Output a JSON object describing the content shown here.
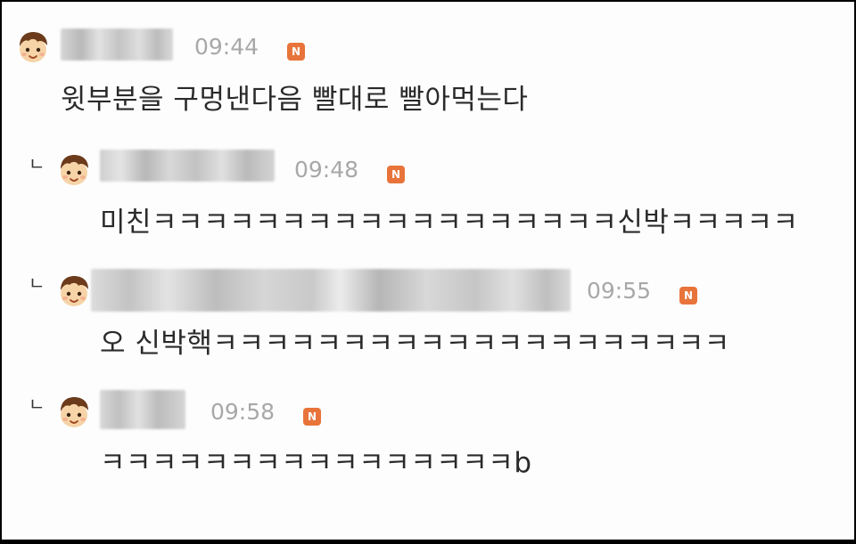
{
  "comments": [
    {
      "is_reply": false,
      "reply_marker": "",
      "time": "09:44",
      "badge": "N",
      "text": "윗부분을 구멍낸다음 빨대로 빨아먹는다",
      "avatar_icon": "boy-face-avatar-icon",
      "username_blurred": true
    },
    {
      "is_reply": true,
      "reply_marker": "ㄴ",
      "time": "09:48",
      "badge": "N",
      "text": "미친ㅋㅋㅋㅋㅋㅋㅋㅋㅋㅋㅋㅋㅋㅋㅋㅋㅋㅋ신박ㅋㅋㅋㅋㅋ",
      "avatar_icon": "boy-face-avatar-icon",
      "username_blurred": true
    },
    {
      "is_reply": true,
      "reply_marker": "ㄴ",
      "time": "09:55",
      "badge": "N",
      "text": "오 신박핵ㅋㅋㅋㅋㅋㅋㅋㅋㅋㅋㅋㅋㅋㅋㅋㅋㅋㅋㅋㅋ",
      "avatar_icon": "boy-face-avatar-icon",
      "username_blurred": true
    },
    {
      "is_reply": true,
      "reply_marker": "ㄴ",
      "time": "09:58",
      "badge": "N",
      "text": "ㅋㅋㅋㅋㅋㅋㅋㅋㅋㅋㅋㅋㅋㅋㅋㅋb",
      "avatar_icon": "boy-face-avatar-icon",
      "username_blurred": true
    }
  ],
  "colors": {
    "badge": "#e8743b",
    "time": "#a8a8a8",
    "text": "#2a2a2a",
    "frame": "#000000",
    "background": "#fdfdfd"
  }
}
